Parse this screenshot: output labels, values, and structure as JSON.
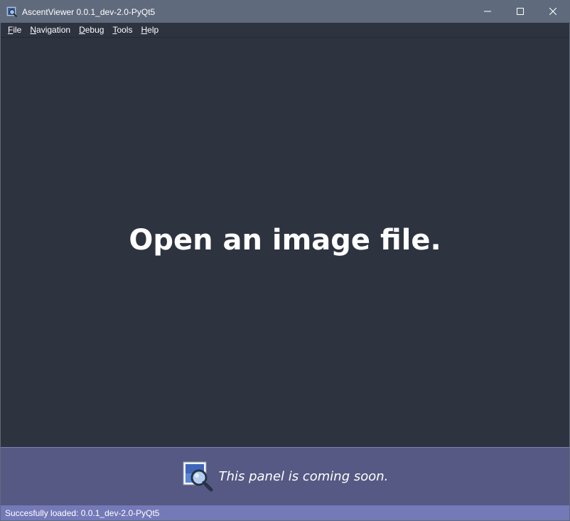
{
  "window": {
    "title": "AscentViewer 0.0.1_dev-2.0-PyQt5",
    "controls": {
      "minimize_icon": "minimize-icon",
      "maximize_icon": "maximize-icon",
      "close_icon": "close-icon"
    }
  },
  "menubar": {
    "items": [
      {
        "mnemonic": "F",
        "rest": "ile"
      },
      {
        "mnemonic": "N",
        "rest": "avigation"
      },
      {
        "mnemonic": "D",
        "rest": "ebug"
      },
      {
        "mnemonic": "T",
        "rest": "ools"
      },
      {
        "mnemonic": "H",
        "rest": "elp"
      }
    ]
  },
  "main": {
    "placeholder": "Open an image file."
  },
  "bottom_panel": {
    "icon": "image-viewer-icon",
    "message": "This panel is coming soon."
  },
  "statusbar": {
    "message": "Succesfully loaded: 0.0.1_dev-2.0-PyQt5"
  },
  "colors": {
    "titlebar": "#5f6b7c",
    "background": "#2e3340",
    "panel": "#565983",
    "statusbar": "#7479b8",
    "text": "#ffffff"
  }
}
